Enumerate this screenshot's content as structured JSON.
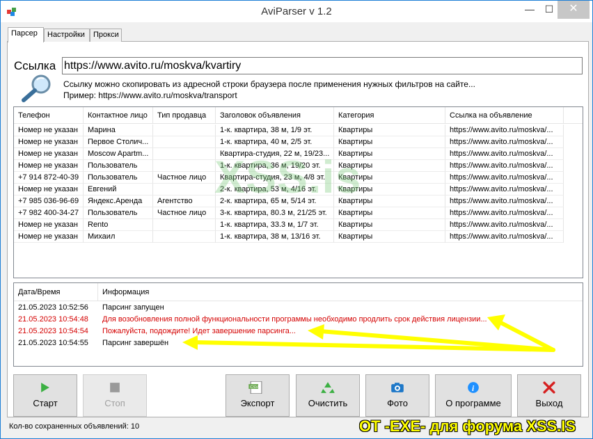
{
  "window": {
    "title": "AviParser v 1.2",
    "minimize": "—",
    "maximize": "☐",
    "close": "✕"
  },
  "tabs": [
    "Парсер",
    "Настройки",
    "Прокси"
  ],
  "link": {
    "label": "Ссылка",
    "value": "https://www.avito.ru/moskva/kvartiry",
    "hint": "Ссылку можно скопировать из адресной строки браузера после применения нужных фильтров на сайте...",
    "example": "Пример: https://www.avito.ru/moskva/transport"
  },
  "grid": {
    "columns": [
      "Телефон",
      "Контактное лицо",
      "Тип продавца",
      "Заголовок объявления",
      "Категория",
      "Ссылка на объявление"
    ],
    "rows": [
      [
        "Номер не указан",
        "Марина",
        "",
        "1-к. квартира, 38 м, 1/9 эт.",
        "Квартиры",
        "https://www.avito.ru/moskva/..."
      ],
      [
        "Номер не указан",
        "Первое Столич...",
        "",
        "1-к. квартира, 40 м, 2/5 эт.",
        "Квартиры",
        "https://www.avito.ru/moskva/..."
      ],
      [
        "Номер не указан",
        "Moscow Apartm...",
        "",
        "Квартира-студия, 22 м, 19/23...",
        "Квартиры",
        "https://www.avito.ru/moskva/..."
      ],
      [
        "Номер не указан",
        "Пользователь",
        "",
        "1-к. квартира, 36 м, 19/20 эт.",
        "Квартиры",
        "https://www.avito.ru/moskva/..."
      ],
      [
        "+7 914 872-40-39",
        "Пользователь",
        "Частное лицо",
        "Квартира-студия, 23 м, 4/8 эт.",
        "Квартиры",
        "https://www.avito.ru/moskva/..."
      ],
      [
        "Номер не указан",
        "Евгений",
        "",
        "2-к. квартира, 53 м, 4/16 эт.",
        "Квартиры",
        "https://www.avito.ru/moskva/..."
      ],
      [
        "+7 985 036-96-69",
        "Яндекс.Аренда",
        "Агентство",
        "2-к. квартира, 65 м, 5/14 эт.",
        "Квартиры",
        "https://www.avito.ru/moskva/..."
      ],
      [
        "+7 982 400-34-27",
        "Пользователь",
        "Частное лицо",
        "3-к. квартира, 80.3 м, 21/25 эт.",
        "Квартиры",
        "https://www.avito.ru/moskva/..."
      ],
      [
        "Номер не указан",
        "Rento",
        "",
        "1-к. квартира, 33.3 м, 1/7 эт.",
        "Квартиры",
        "https://www.avito.ru/moskva/..."
      ],
      [
        "Номер не указан",
        "Михаил",
        "",
        "1-к. квартира, 38 м, 13/16 эт.",
        "Квартиры",
        "https://www.avito.ru/moskva/..."
      ]
    ]
  },
  "log": {
    "columns": [
      "Дата/Время",
      "Информация"
    ],
    "rows": [
      {
        "time": "21.05.2023 10:52:56",
        "info": "Парсинг запущен",
        "red": false
      },
      {
        "time": "21.05.2023 10:54:48",
        "info": "Для возобновления полной функциональности программы необходимо продлить срок действия лицензии...",
        "red": true
      },
      {
        "time": "21.05.2023 10:54:54",
        "info": "Пожалуйста, подождите! Идет завершение парсинга...",
        "red": true
      },
      {
        "time": "21.05.2023 10:54:55",
        "info": "Парсинг завершён",
        "red": false
      }
    ]
  },
  "buttons": {
    "start": "Старт",
    "stop": "Стоп",
    "export": "Экспорт",
    "clear": "Очистить",
    "photo": "Фото",
    "about": "О программе",
    "exit": "Выход"
  },
  "export_icon_text": "CSV",
  "status": "Кол-во сохраненных объявлений: 10",
  "watermarks": {
    "bottom": "ОТ -EXE- для форума XSS.IS",
    "center": "XSS.is"
  },
  "colors": {
    "log_error": "#d40000",
    "start_icon": "#3cb043",
    "exit_icon": "#d62020",
    "info_icon": "#1e90ff",
    "arrow": "#ffff00"
  }
}
